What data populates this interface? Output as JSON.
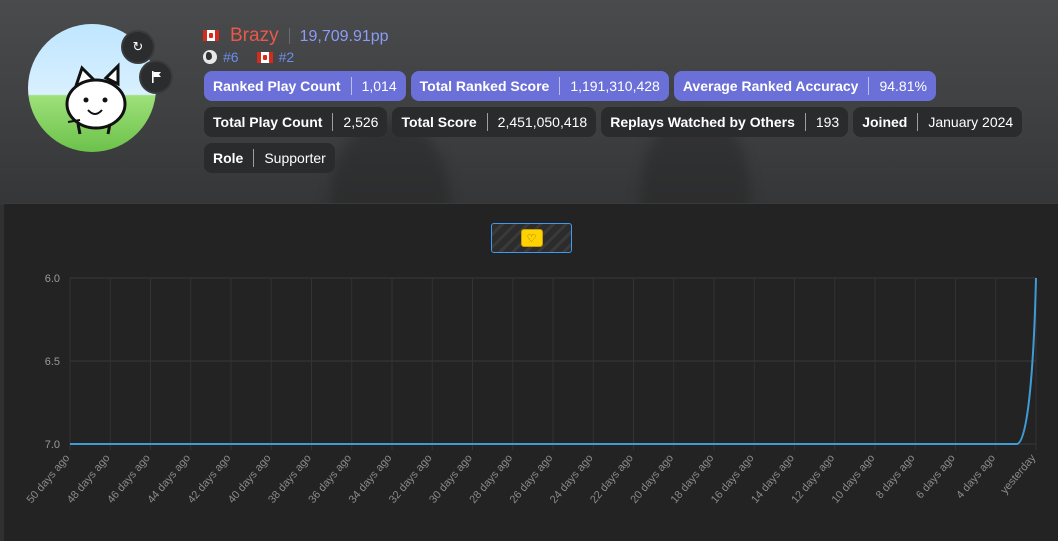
{
  "user": {
    "name": "Brazy",
    "pp": "19,709.91pp",
    "global_rank": "#6",
    "country_rank": "#2",
    "country_flag_icon": "canada-flag-icon"
  },
  "stats_row1": [
    {
      "label": "Ranked Play Count",
      "value": "1,014"
    },
    {
      "label": "Total Ranked Score",
      "value": "1,191,310,428"
    },
    {
      "label": "Average Ranked Accuracy",
      "value": "94.81%"
    }
  ],
  "stats_row2": [
    {
      "label": "Total Play Count",
      "value": "2,526"
    },
    {
      "label": "Total Score",
      "value": "2,451,050,418"
    },
    {
      "label": "Replays Watched by Others",
      "value": "193"
    },
    {
      "label": "Joined",
      "value": "January 2024"
    }
  ],
  "stats_row3": [
    {
      "label": "Role",
      "value": "Supporter"
    }
  ],
  "colors": {
    "accent_pill": "#6b70d8",
    "username": "#e8594b",
    "pp": "#8c9cf6",
    "rank": "#6c8eea",
    "line": "#3f9bd6"
  },
  "chart_data": {
    "type": "line",
    "x": [
      "50 days ago",
      "48 days ago",
      "46 days ago",
      "44 days ago",
      "42 days ago",
      "40 days ago",
      "38 days ago",
      "36 days ago",
      "34 days ago",
      "32 days ago",
      "30 days ago",
      "28 days ago",
      "26 days ago",
      "24 days ago",
      "22 days ago",
      "20 days ago",
      "18 days ago",
      "16 days ago",
      "14 days ago",
      "12 days ago",
      "10 days ago",
      "8 days ago",
      "6 days ago",
      "4 days ago",
      "yesterday"
    ],
    "series": [
      {
        "values": [
          7,
          7,
          7,
          7,
          7,
          7,
          7,
          7,
          7,
          7,
          7,
          7,
          7,
          7,
          7,
          7,
          7,
          7,
          7,
          7,
          7,
          7,
          7,
          7,
          7,
          7,
          7,
          7,
          7,
          7,
          7,
          7,
          7,
          7,
          7,
          7,
          7,
          7,
          7,
          7,
          7,
          7,
          7,
          7,
          7,
          7,
          7,
          7,
          7,
          7,
          6
        ]
      }
    ],
    "y_ticks": [
      "6.0",
      "6.5",
      "7.0"
    ],
    "ylim": [
      6,
      7
    ],
    "y_inverted": true,
    "grid": true
  }
}
